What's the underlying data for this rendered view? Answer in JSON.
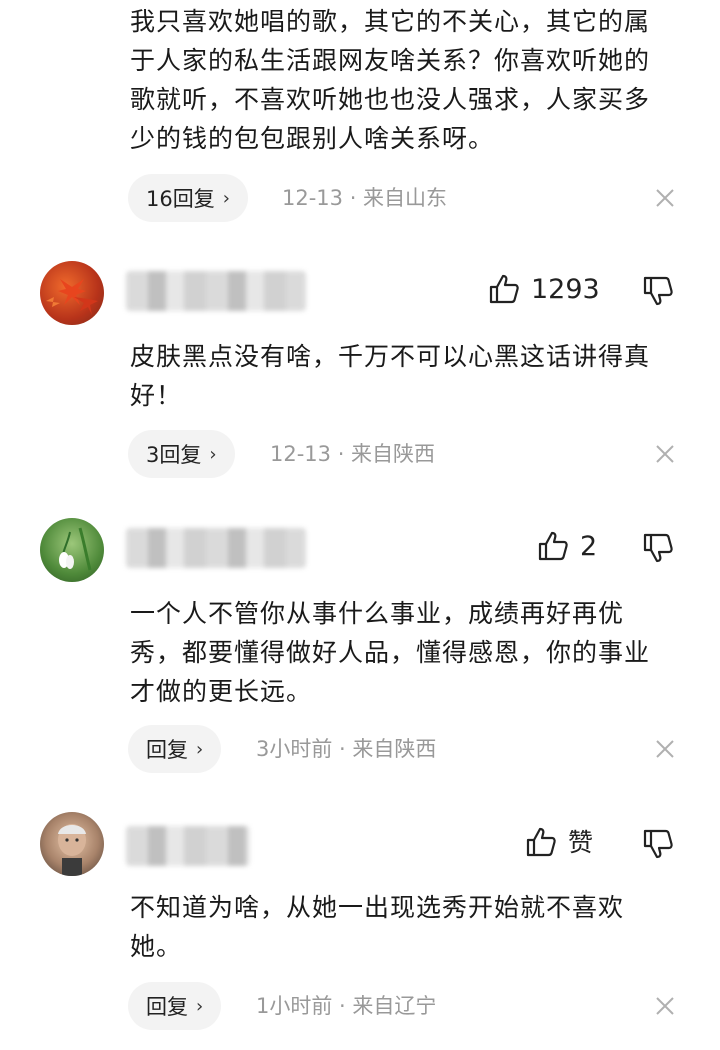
{
  "comments": [
    {
      "text": "我只喜欢她唱的歌，其它的不关心，其它的属于人家的私生活跟网友啥关系？你喜欢听她的歌就听，不喜欢听她也也没人强求，人家买多少的钱的包包跟别人啥关系呀。",
      "reply_label": "16回复",
      "meta": "12-13 · 来自山东"
    },
    {
      "avatar_icon": "red-maple-leaves-avatar",
      "likes": "1293",
      "text": "皮肤黑点没有啥，千万不可以心黑这话讲得真好！",
      "reply_label": "3回复",
      "meta": "12-13 · 来自陕西"
    },
    {
      "avatar_icon": "white-flower-avatar",
      "likes": "2",
      "text": "一个人不管你从事什么事业，成绩再好再优秀，都要懂得做好人品，懂得感恩，你的事业才做的更长远。",
      "reply_label": "回复",
      "meta": "3小时前 · 来自陕西"
    },
    {
      "avatar_icon": "elderly-person-avatar",
      "likes": "赞",
      "text": "不知道为啥，从她一出现选秀开始就不喜欢她。",
      "reply_label": "回复",
      "meta": "1小时前 · 来自辽宁"
    }
  ],
  "reply_chevron": "›",
  "colors": {
    "meta_text": "#999999",
    "pill_bg": "#f3f3f3",
    "body_text": "#1a1a1a"
  }
}
